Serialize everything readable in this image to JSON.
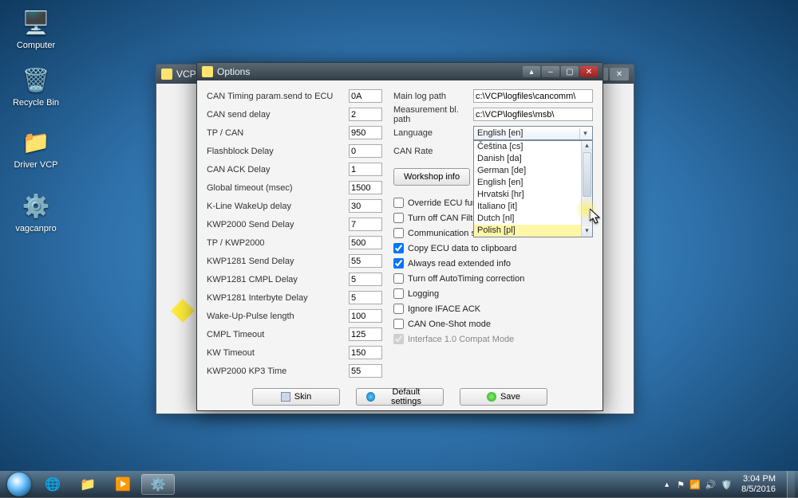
{
  "desktop": {
    "icons": [
      {
        "label": "Computer",
        "glyph": "🖥️"
      },
      {
        "label": "Recycle Bin",
        "glyph": "🗑️"
      },
      {
        "label": "Driver VCP",
        "glyph": "📁"
      },
      {
        "label": "vagcanpro",
        "glyph": "⚙️"
      }
    ]
  },
  "back_window": {
    "title": "VCP"
  },
  "window": {
    "title": "Options",
    "left": [
      {
        "label": "CAN Timing param.send to ECU",
        "value": "0A"
      },
      {
        "label": "CAN send delay",
        "value": "2"
      },
      {
        "label": "TP / CAN",
        "value": "950"
      },
      {
        "label": "Flashblock Delay",
        "value": "0"
      },
      {
        "label": "CAN ACK Delay",
        "value": "1"
      },
      {
        "label": "Global timeout (msec)",
        "value": "1500"
      },
      {
        "label": "K-Line WakeUp delay",
        "value": "30"
      },
      {
        "label": "KWP2000 Send Delay",
        "value": "7"
      },
      {
        "label": "TP / KWP2000",
        "value": "500"
      },
      {
        "label": "KWP1281 Send Delay",
        "value": "55"
      },
      {
        "label": "KWP1281 CMPL Delay",
        "value": "5"
      },
      {
        "label": "KWP1281 Interbyte Delay",
        "value": "5"
      },
      {
        "label": "Wake-Up-Pulse length",
        "value": "100"
      },
      {
        "label": "CMPL Timeout",
        "value": "125"
      },
      {
        "label": "KW Timeout",
        "value": "150"
      },
      {
        "label": "KWP2000 KP3 Time",
        "value": "55"
      }
    ],
    "right": {
      "main_log_label": "Main log path",
      "main_log_value": "c:\\VCP\\logfiles\\cancomm\\",
      "meas_label": "Measurement bl. path",
      "meas_value": "c:\\VCP\\logfiles\\msb\\",
      "language_label": "Language",
      "language_selected": "English [en]",
      "language_options": [
        "Čeština [cs]",
        "Danish [da]",
        "German [de]",
        "English [en]",
        "Hrvatski [hr]",
        "Italiano [it]",
        "Dutch [nl]",
        "Polish [pl]"
      ],
      "can_rate_label": "CAN Rate",
      "workshop_btn": "Workshop info",
      "checks": [
        {
          "label": "Override ECU functions",
          "checked": false,
          "disabled": false
        },
        {
          "label": "Turn off CAN Filter",
          "checked": false,
          "disabled": false
        },
        {
          "label": "Communication starts automatically",
          "checked": false,
          "disabled": false,
          "truncated": "Communication starts autom"
        },
        {
          "label": "Copy ECU data to clipboard",
          "checked": true,
          "disabled": false
        },
        {
          "label": "Always read extended info",
          "checked": true,
          "disabled": false
        },
        {
          "label": "Turn off AutoTiming correction",
          "checked": false,
          "disabled": false
        },
        {
          "label": "Logging",
          "checked": false,
          "disabled": false
        },
        {
          "label": "Ignore IFACE ACK",
          "checked": false,
          "disabled": false
        },
        {
          "label": "CAN One-Shot mode",
          "checked": false,
          "disabled": false
        },
        {
          "label": "Interface 1.0 Compat Mode",
          "checked": true,
          "disabled": true
        }
      ]
    },
    "footer": {
      "skin": "Skin",
      "default": "Default settings",
      "save": "Save"
    }
  },
  "tray": {
    "time": "3:04 PM",
    "date": "8/5/2016"
  }
}
